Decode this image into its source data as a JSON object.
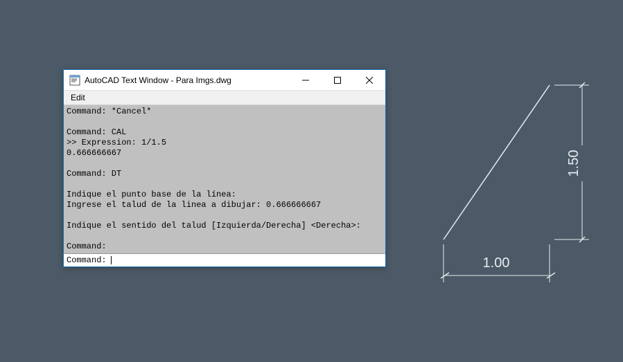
{
  "window": {
    "title": "AutoCAD Text Window - Para Imgs.dwg",
    "menu": {
      "edit": "Edit"
    },
    "history": "Command: *Cancel*\n\nCommand: CAL\n>> Expression: 1/1.5\n0.666666667\n\nCommand: DT\n\nIndique el punto base de la línea:\nIngrese el talud de la linea a dibujar: 0.666666667\n\nIndique el sentido del talud [Izquierda/Derecha] <Derecha>:\n\nCommand:",
    "prompt": "Command:",
    "input_value": ""
  },
  "drawing": {
    "dim_h": "1.00",
    "dim_v": "1.50"
  }
}
